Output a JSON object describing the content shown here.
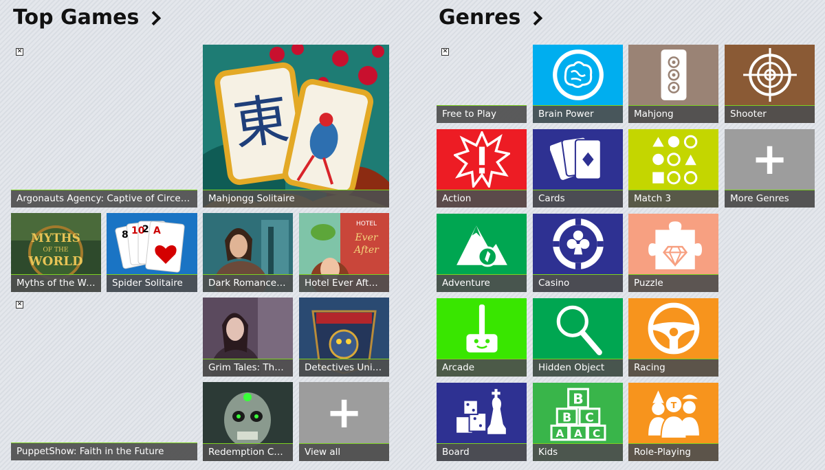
{
  "top_games": {
    "title": "Top Games",
    "tiles": [
      {
        "label": "Argonauts Agency: Captive of Circe C...",
        "broken_image": true
      },
      {
        "label": "Mahjongg Solitaire",
        "art": "mahjong-art"
      },
      {
        "label": "Myths of the Wo...",
        "art": "myths-art"
      },
      {
        "label": "Spider Solitaire",
        "art": "spider-art"
      },
      {
        "label": "Dark Romance:...",
        "art": "dark-romance-art"
      },
      {
        "label": "Hotel Ever After:...",
        "art": "hotel-art"
      },
      {
        "label": "PuppetShow: Faith in the Future",
        "broken_image": true
      },
      {
        "label": "Grim Tales: The...",
        "art": "grim-tales-art"
      },
      {
        "label": "Detectives Unite...",
        "art": "detectives-art"
      },
      {
        "label": "Redemption Ce...",
        "art": "redemption-art"
      },
      {
        "label": "View all",
        "icon": "plus-icon"
      }
    ]
  },
  "genres": {
    "title": "Genres",
    "tiles": [
      {
        "label": "Free to Play",
        "broken_image": true
      },
      {
        "label": "Brain Power",
        "color": "#00aeef",
        "icon": "brain-icon"
      },
      {
        "label": "Mahjong",
        "color": "#9a8375",
        "icon": "mahjong-tile-icon"
      },
      {
        "label": "Shooter",
        "color": "#8a5a35",
        "icon": "crosshair-icon"
      },
      {
        "label": "Action",
        "color": "#ed1c24",
        "icon": "explosion-icon"
      },
      {
        "label": "Cards",
        "color": "#2e3192",
        "icon": "cards-icon"
      },
      {
        "label": "Match 3",
        "color": "#c4d600",
        "icon": "shapes-icon"
      },
      {
        "label": "More Genres",
        "color": "#9d9d9d",
        "icon": "plus-icon"
      },
      {
        "label": "Adventure",
        "color": "#00a651",
        "icon": "mountain-compass-icon"
      },
      {
        "label": "Casino",
        "color": "#2e3192",
        "icon": "casino-chip-icon"
      },
      {
        "label": "Puzzle",
        "color": "#f7a081",
        "icon": "puzzle-piece-icon"
      },
      {
        "label": "Arcade",
        "color": "#39e600",
        "icon": "joystick-icon"
      },
      {
        "label": "Hidden Object",
        "color": "#00a651",
        "icon": "magnifier-icon"
      },
      {
        "label": "Racing",
        "color": "#f7941d",
        "icon": "steering-wheel-icon"
      },
      {
        "label": "Board",
        "color": "#2e3192",
        "icon": "dice-chess-icon"
      },
      {
        "label": "Kids",
        "color": "#39b54a",
        "icon": "abc-blocks-icon"
      },
      {
        "label": "Role-Playing",
        "color": "#f7941d",
        "icon": "characters-icon"
      }
    ]
  }
}
